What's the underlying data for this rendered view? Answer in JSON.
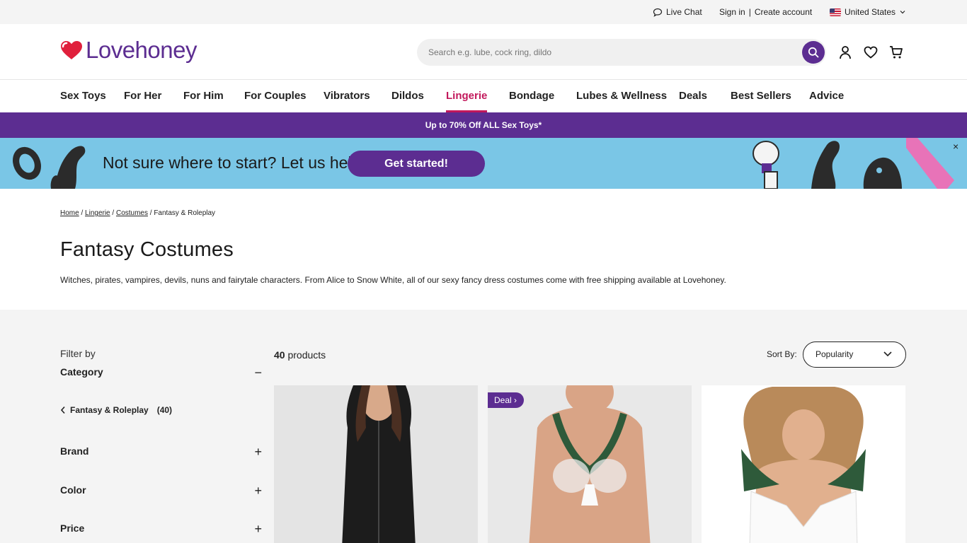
{
  "topbar": {
    "live_chat": "Live Chat",
    "sign_in": "Sign in",
    "separator": "|",
    "create_account": "Create account",
    "country": "United States"
  },
  "header": {
    "logo_text": "Lovehoney",
    "search_placeholder": "Search e.g. lube, cock ring, dildo",
    "brand_color": "#5c2d91"
  },
  "nav": {
    "items": [
      "Sex Toys",
      "For Her",
      "For Him",
      "For Couples",
      "Vibrators",
      "Dildos",
      "Lingerie",
      "Bondage",
      "Lubes & Wellness",
      "Deals",
      "Best Sellers",
      "Advice"
    ],
    "active": "Lingerie"
  },
  "promo": {
    "text": "Up to 70% Off ALL Sex Toys*"
  },
  "help_banner": {
    "message": "Not sure where to start? Let us help",
    "cta": "Get started!",
    "close": "×"
  },
  "breadcrumb": {
    "home": "Home",
    "lingerie": "Lingerie",
    "costumes": "Costumes",
    "sep": "/",
    "current": "Fantasy & Roleplay"
  },
  "page": {
    "title": "Fantasy Costumes",
    "description": "Witches, pirates, vampires, devils, nuns and fairytale characters. From Alice to Snow White, all of our sexy fancy dress costumes come with free shipping available at Lovehoney."
  },
  "filters": {
    "heading": "Filter by",
    "category": {
      "label": "Category",
      "toggle": "−"
    },
    "selected_category": {
      "label": "Fantasy & Roleplay",
      "count": "(40)"
    },
    "brand": {
      "label": "Brand",
      "toggle": "+"
    },
    "color": {
      "label": "Color",
      "toggle": "+"
    },
    "price": {
      "label": "Price",
      "toggle": "+"
    }
  },
  "results": {
    "count": "40",
    "count_suffix": "products",
    "sort_label": "Sort By:",
    "sort_value": "Popularity"
  },
  "products": [
    {
      "badge": ""
    },
    {
      "badge": "Deal"
    },
    {
      "badge": ""
    }
  ]
}
